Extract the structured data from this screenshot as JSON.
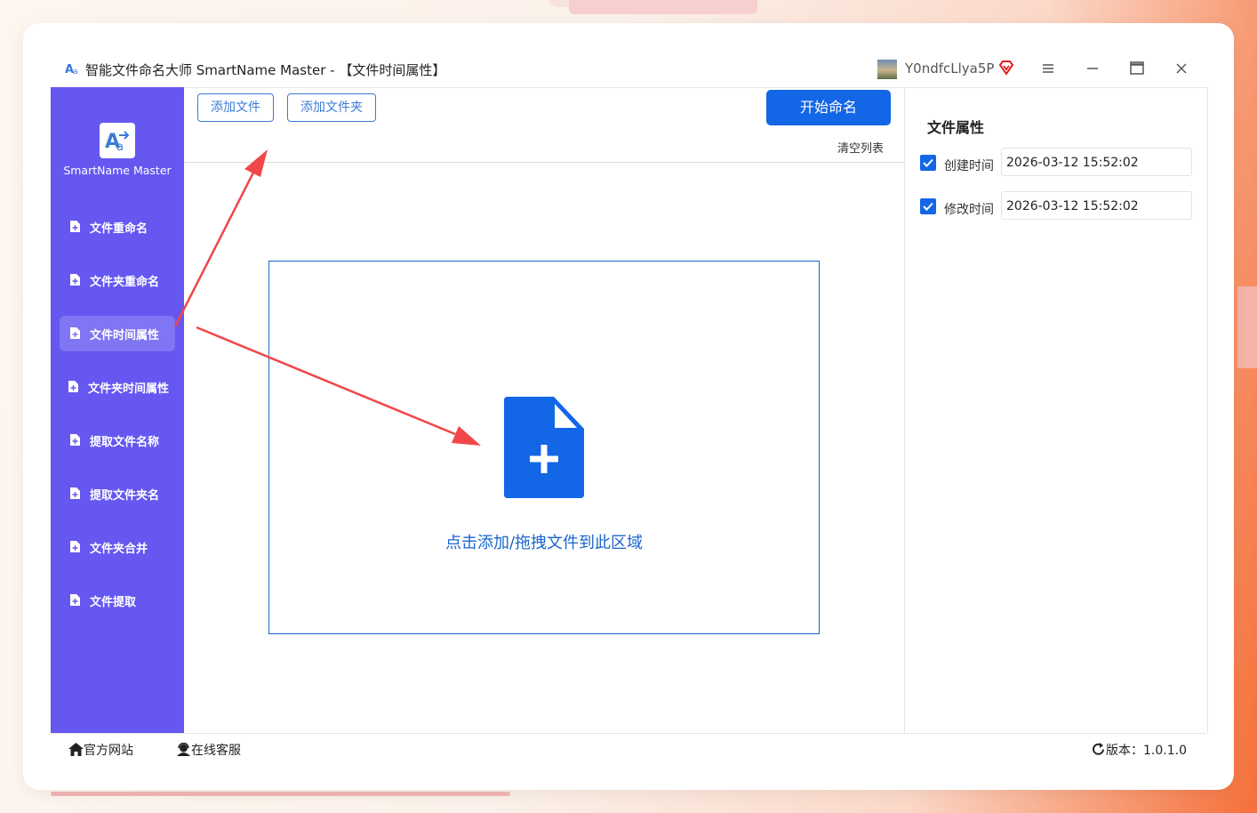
{
  "window": {
    "title": "智能文件命名大师 SmartName Master - 【文件时间属性】",
    "username": "Y0ndfcLlya5P"
  },
  "sidebar": {
    "logo_text": "SmartName Master",
    "items": [
      {
        "label": "文件重命名"
      },
      {
        "label": "文件夹重命名"
      },
      {
        "label": "文件时间属性",
        "active": true
      },
      {
        "label": "文件夹时间属性"
      },
      {
        "label": "提取文件名称"
      },
      {
        "label": "提取文件夹名"
      },
      {
        "label": "文件夹合并"
      },
      {
        "label": "文件提取"
      }
    ]
  },
  "toolbar": {
    "add_file": "添加文件",
    "add_folder": "添加文件夹",
    "start": "开始命名",
    "clear": "清空列表"
  },
  "dropzone": {
    "text": "点击添加/拖拽文件到此区域"
  },
  "properties": {
    "title": "文件属性",
    "created": {
      "label": "创建时间",
      "value": "2026-03-12 15:52:02",
      "checked": true
    },
    "modified": {
      "label": "修改时间",
      "value": "2026-03-12 15:52:02",
      "checked": true
    }
  },
  "footer": {
    "website": "官方网站",
    "support": "在线客服",
    "version": "版本：1.0.1.0"
  },
  "colors": {
    "sidebar": "#6557f0",
    "accent": "#1366e6",
    "arrow": "#f0474a"
  }
}
